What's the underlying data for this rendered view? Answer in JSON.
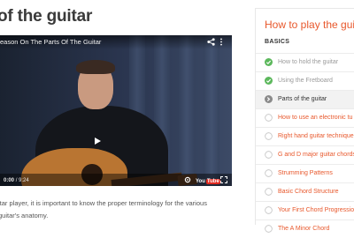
{
  "page": {
    "title": "of the guitar"
  },
  "video": {
    "title": "eason On The Parts Of The Guitar",
    "current_time": "0:00",
    "duration": "9:24",
    "brand": "You",
    "brand_tube": "Tube"
  },
  "caption": {
    "line1": "itar player, it is important to know the proper terminology for the various",
    "line2": "guitar's anatomy."
  },
  "sidebar": {
    "title": "How to play the guitar",
    "section": "BASICS",
    "lessons": [
      {
        "label": "How to hold the guitar",
        "status": "completed"
      },
      {
        "label": "Using the Fretboard",
        "status": "completed"
      },
      {
        "label": "Parts of the guitar",
        "status": "current"
      },
      {
        "label": "How to use an electronic tu",
        "status": "pending"
      },
      {
        "label": "Right hand guitar technique",
        "status": "pending"
      },
      {
        "label": "G and D major guitar chords",
        "status": "pending"
      },
      {
        "label": "Strumming Patterns",
        "status": "pending"
      },
      {
        "label": "Basic Chord Structure",
        "status": "pending"
      },
      {
        "label": "Your First Chord Progressio",
        "status": "pending"
      },
      {
        "label": "The A Minor Chord",
        "status": "pending"
      }
    ]
  },
  "colors": {
    "accent": "#e8582c",
    "completed": "#5cb85c",
    "current": "#8a8a8a"
  }
}
